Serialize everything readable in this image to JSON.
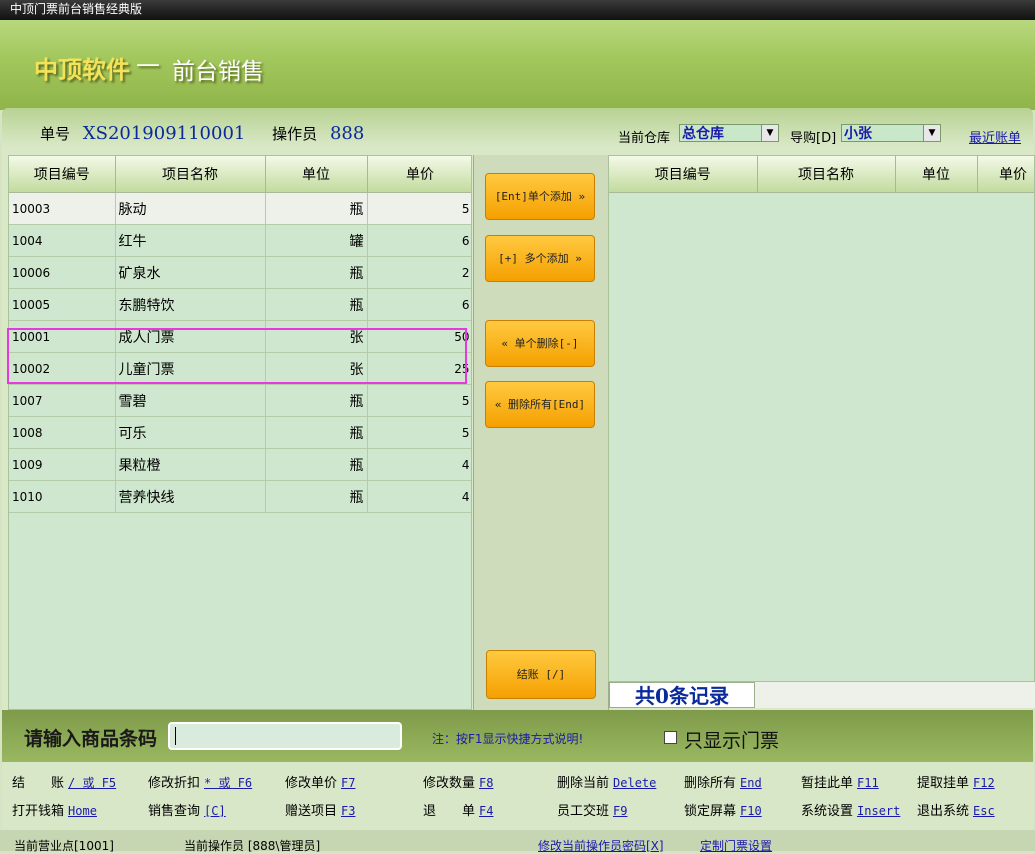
{
  "window": {
    "title": "中顶门票前台销售经典版"
  },
  "banner": {
    "brand": "中顶软件",
    "dash": "—",
    "subtitle": "前台销售"
  },
  "info": {
    "order_label": "单号",
    "order_no": "XS201909110001",
    "operator_label": "操作员",
    "operator_no": "888",
    "warehouse_label": "当前仓库",
    "warehouse": "总仓库",
    "guide_label": "导购[D]",
    "guide": "小张",
    "recent_link": "最近账单"
  },
  "left_table": {
    "headers": [
      "项目编号",
      "项目名称",
      "单位",
      "单价"
    ],
    "rows": [
      [
        "10003",
        "脉动",
        "瓶",
        "5"
      ],
      [
        "1004",
        "红牛",
        "罐",
        "6"
      ],
      [
        "10006",
        "矿泉水",
        "瓶",
        "2"
      ],
      [
        "10005",
        "东鹏特饮",
        "瓶",
        "6"
      ],
      [
        "10001",
        "成人门票",
        "张",
        "50"
      ],
      [
        "10002",
        "儿童门票",
        "张",
        "25"
      ],
      [
        "1007",
        "雪碧",
        "瓶",
        "5"
      ],
      [
        "1008",
        "可乐",
        "瓶",
        "5"
      ],
      [
        "1009",
        "果粒橙",
        "瓶",
        "4"
      ],
      [
        "1010",
        "营养快线",
        "瓶",
        "4"
      ]
    ]
  },
  "buttons": {
    "add_one": "[Ent]单个添加 »",
    "add_many": "[+] 多个添加 »",
    "del_one": "« 单个删除[-]",
    "del_all": "« 删除所有[End]",
    "checkout": "结账 [/]"
  },
  "right_table": {
    "headers": [
      "项目编号",
      "项目名称",
      "单位",
      "单价"
    ],
    "count_text": "共0条记录"
  },
  "barcode": {
    "label": "请输入商品条码",
    "value": "",
    "note": "注：按F1显示快捷方式说明!",
    "only_tickets": "只显示门票"
  },
  "shortcuts": [
    {
      "label": "结　　账",
      "key": "/ 或 F5"
    },
    {
      "label": "修改折扣",
      "key": "* 或 F6"
    },
    {
      "label": "修改单价",
      "key": "F7"
    },
    {
      "label": "修改数量",
      "key": "F8"
    },
    {
      "label": "删除当前",
      "key": "Delete"
    },
    {
      "label": "删除所有",
      "key": "End"
    },
    {
      "label": "暂挂此单",
      "key": "F11"
    },
    {
      "label": "提取挂单",
      "key": "F12"
    },
    {
      "label": "打开钱箱",
      "key": "Home"
    },
    {
      "label": "销售查询",
      "key": "[C]"
    },
    {
      "label": "赠送项目",
      "key": "F3"
    },
    {
      "label": "退　　单",
      "key": "F4"
    },
    {
      "label": "员工交班",
      "key": "F9"
    },
    {
      "label": "锁定屏幕",
      "key": "F10"
    },
    {
      "label": "系统设置",
      "key": "Insert"
    },
    {
      "label": "退出系统",
      "key": "Esc"
    }
  ],
  "status": {
    "point": "当前营业点[1001]",
    "operator": "当前操作员 [888\\管理员]",
    "change_pwd": "修改当前操作员密码[X]",
    "custom": "定制门票设置"
  }
}
